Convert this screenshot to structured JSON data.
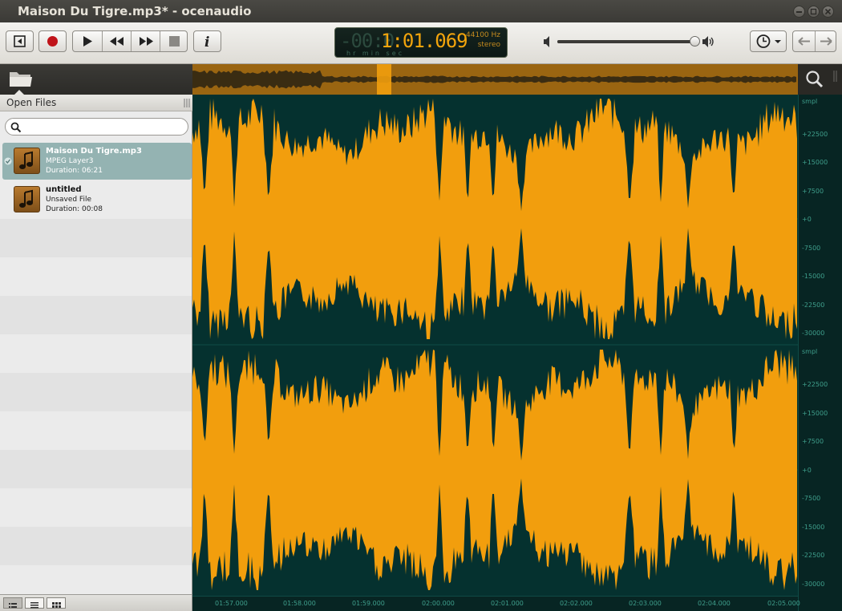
{
  "window": {
    "title": "Maison Du Tigre.mp3* - ocenaudio"
  },
  "toolbar": {
    "time_ghost": "-00:0",
    "time": "1:01.069",
    "sample_rate": "44100 Hz",
    "channels": "stereo",
    "time_units": "hr  min  sec",
    "volume_level": 0.98
  },
  "sidebar": {
    "section_title": "Open Files",
    "search_placeholder": "",
    "files": [
      {
        "name": "Maison Du Tigre.mp3",
        "type": "MPEG Layer3",
        "duration": "Duration: 06:21",
        "selected": true
      },
      {
        "name": "untitled",
        "type": "Unsaved File",
        "duration": "Duration: 00:08",
        "selected": false
      }
    ]
  },
  "waveform": {
    "channel_top": {
      "unit": "smpl",
      "ticks": [
        "+22500",
        "+15000",
        "+7500",
        "+0",
        "-7500",
        "-15000",
        "-22500",
        "-30000"
      ]
    },
    "channel_bottom": {
      "unit": "smpl",
      "ticks": [
        "+22500",
        "+15000",
        "+7500",
        "+0",
        "-7500",
        "-15000",
        "-22500",
        "-30000"
      ]
    },
    "timeline": [
      "01:57.000",
      "01:58.000",
      "01:59.000",
      "02:00.000",
      "02:01.000",
      "02:02.000",
      "02:03.000",
      "02:04.000",
      "02:05.000"
    ]
  },
  "colors": {
    "wave_fill": "#f29e0d",
    "wave_background": "#05312f",
    "selection": "#94b3b2",
    "lcd_digits": "#f2a40c"
  },
  "icons": {
    "open": "folder-icon",
    "zoom": "magnifier-icon",
    "transport": [
      "rewind-start-icon",
      "record-icon",
      "play-icon",
      "rewind-icon",
      "fast-forward-icon",
      "stop-icon",
      "info-icon"
    ],
    "volume": [
      "speaker-low-icon",
      "speaker-high-icon"
    ],
    "history": [
      "clock-icon",
      "back-arrow-icon",
      "forward-arrow-icon"
    ]
  }
}
